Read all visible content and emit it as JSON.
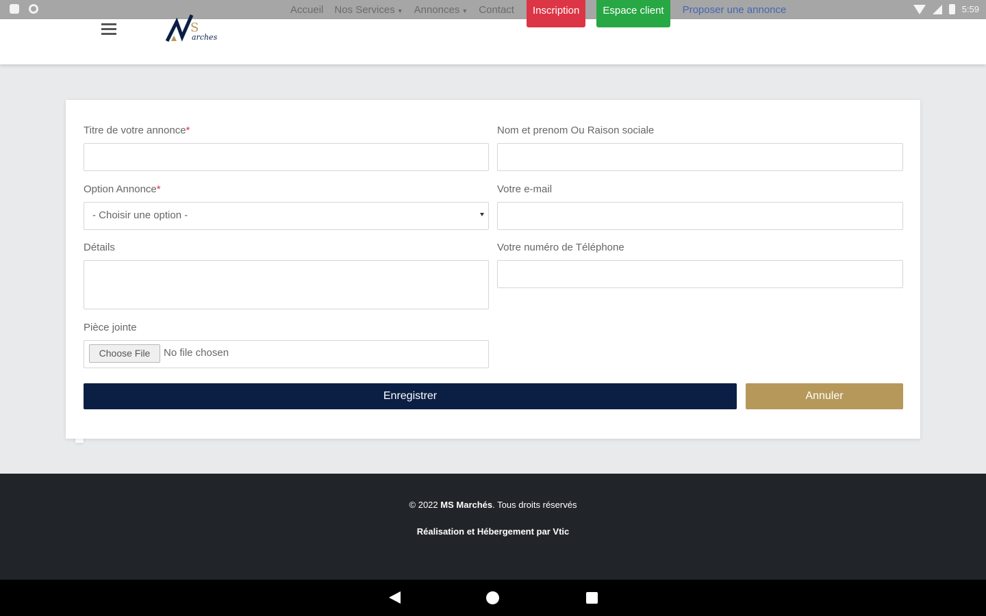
{
  "nav": {
    "accueil": "Accueil",
    "services": "Nos Services",
    "annonces": "Annonces",
    "contact": "Contact",
    "inscription": "Inscription",
    "espace_client": "Espace client",
    "proposer": "Proposer une annonce"
  },
  "status": {
    "time": "5:59"
  },
  "form": {
    "titre_label": "Titre de votre annonce",
    "nom_label": "Nom et prenom Ou Raison sociale",
    "option_label": "Option Annonce",
    "option_value": "- Choisir une option -",
    "email_label": "Votre e-mail",
    "details_label": "Détails",
    "telephone_label": "Votre numéro de Téléphone",
    "piece_label": "Pièce jointe",
    "file_button": "Choose File",
    "file_status": "No file chosen",
    "required_mark": "*",
    "save_label": "Enregistrer",
    "cancel_label": "Annuler"
  },
  "footer": {
    "copyright_prefix": "© 2022",
    "brand": "MS Marchés",
    "copyright_suffix": ". Tous droits réservés",
    "credit": "Réalisation et Hébergement par Vtic"
  },
  "colors": {
    "save_button": "#0b1f45",
    "cancel_button": "#b5985a",
    "inscription": "#dc3545",
    "espace_client": "#28a745",
    "footer": "#212529"
  }
}
